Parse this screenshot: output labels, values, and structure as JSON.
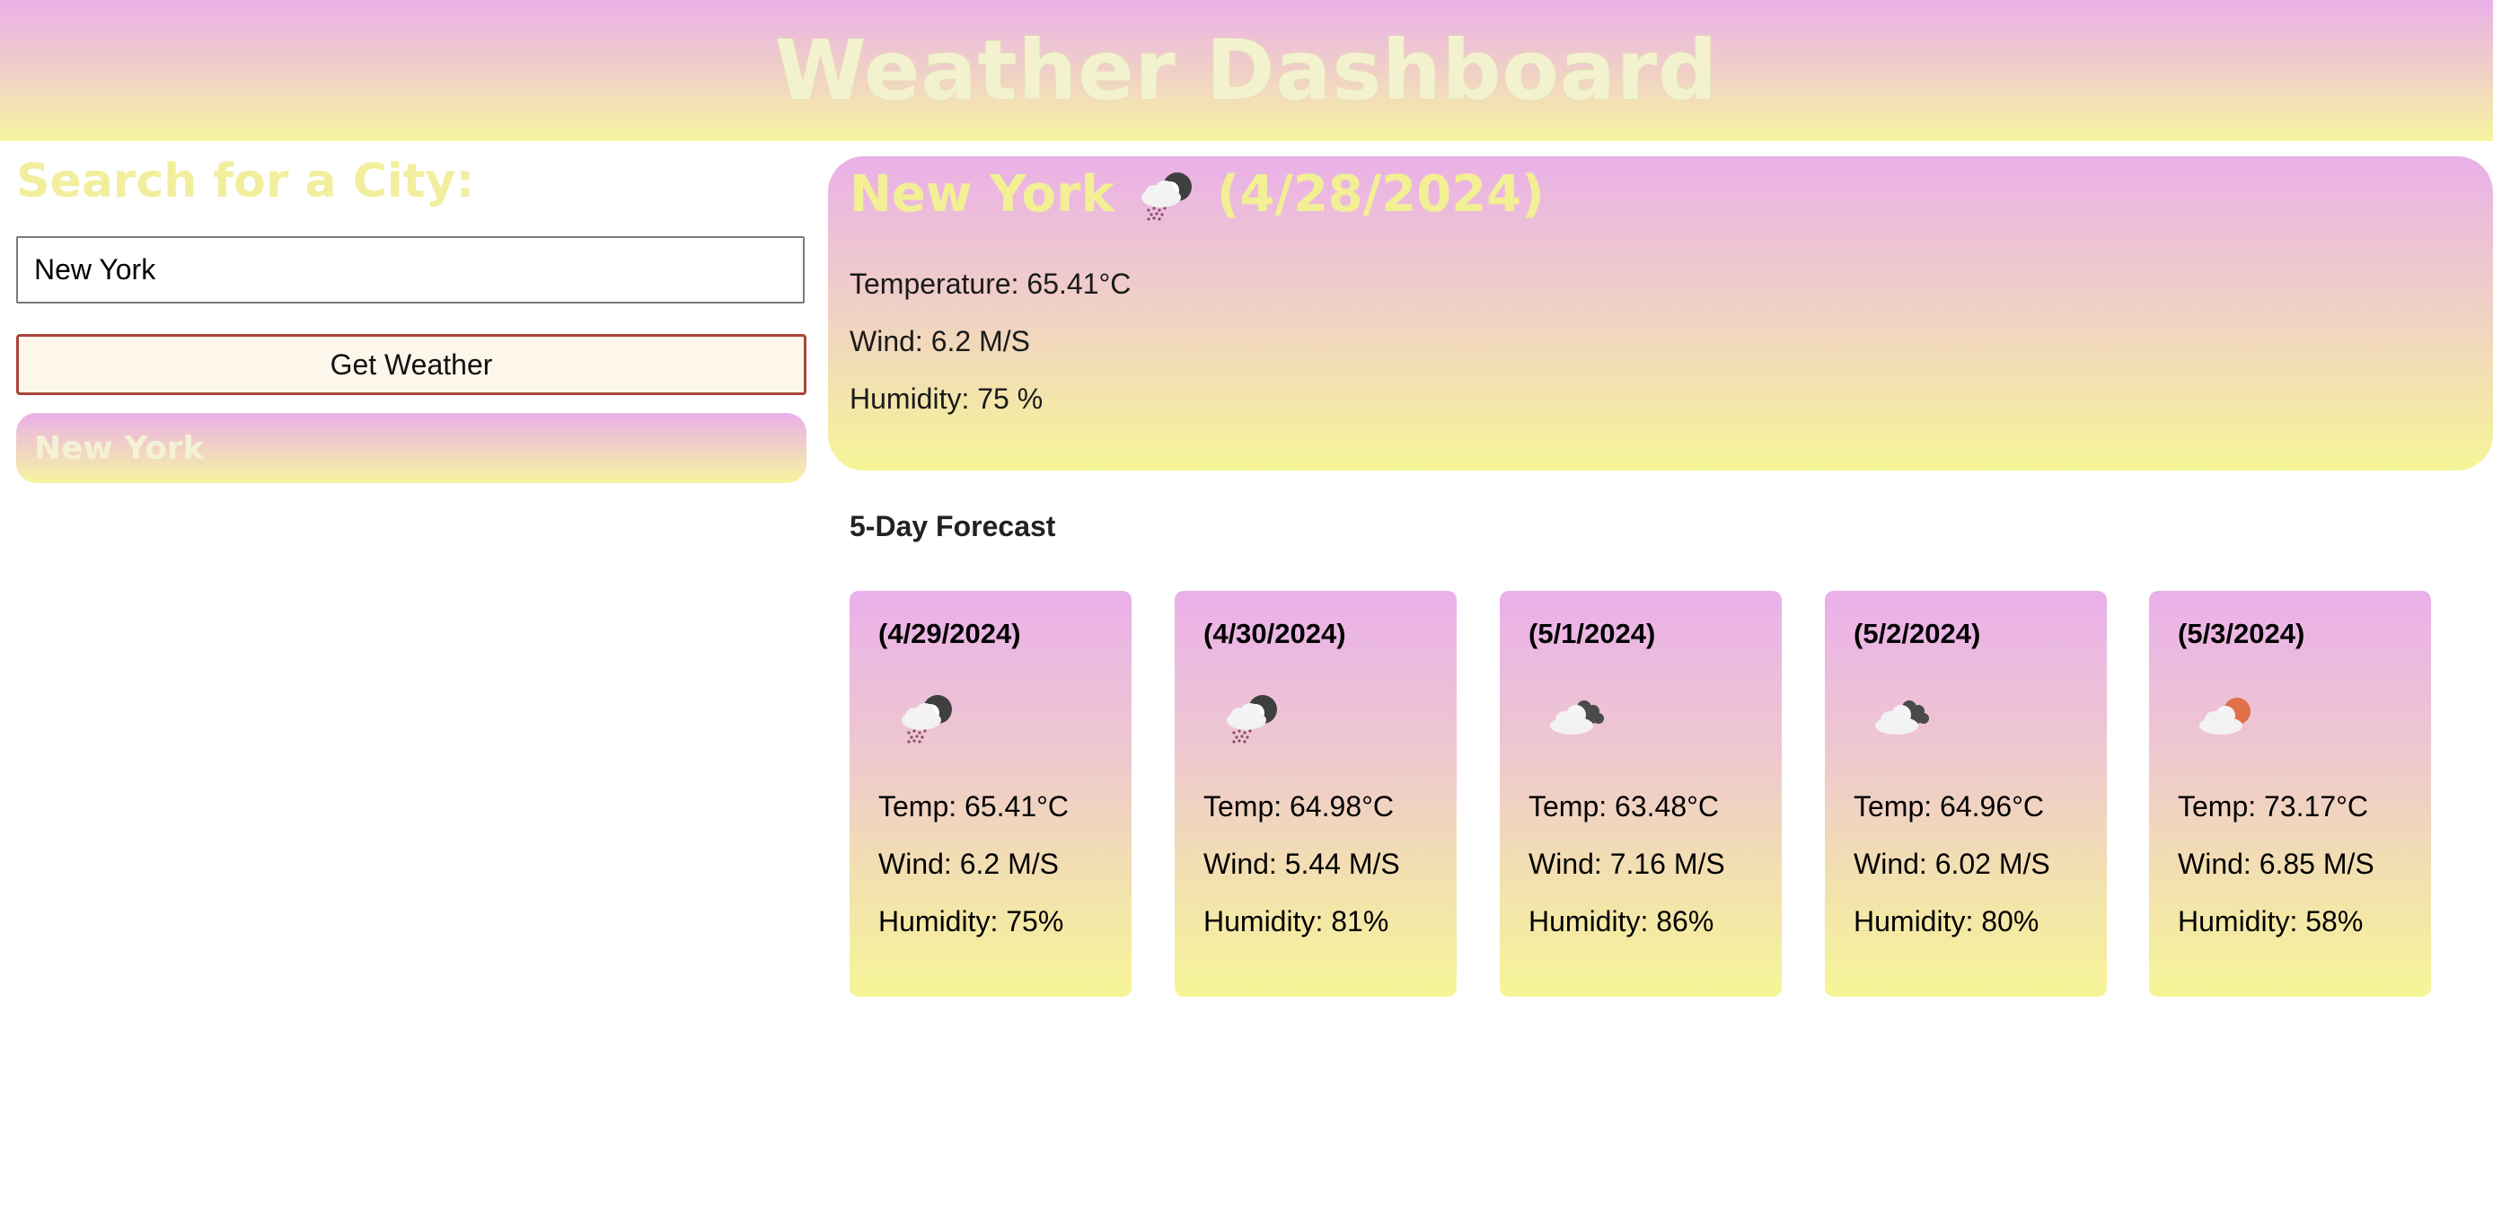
{
  "header": {
    "title": "Weather Dashboard"
  },
  "search": {
    "heading": "Search for a City:",
    "input_value": "New York",
    "button_label": "Get Weather",
    "history": [
      "New York"
    ]
  },
  "current": {
    "city": "New York",
    "icon": "rain-cloud-moon-icon",
    "date": "(4/28/2024)",
    "temperature": "Temperature: 65.41°C",
    "wind": "Wind: 6.2 M/S",
    "humidity": "Humidity: 75 %"
  },
  "forecast": {
    "heading": "5-Day Forecast",
    "days": [
      {
        "date": "(4/29/2024)",
        "icon": "rain-cloud-moon-icon",
        "temp": "Temp: 65.41°C",
        "wind": "Wind: 6.2 M/S",
        "humidity": "Humidity: 75%"
      },
      {
        "date": "(4/30/2024)",
        "icon": "rain-cloud-moon-icon",
        "temp": "Temp: 64.98°C",
        "wind": "Wind: 5.44 M/S",
        "humidity": "Humidity: 81%"
      },
      {
        "date": "(5/1/2024)",
        "icon": "broken-clouds-icon",
        "temp": "Temp: 63.48°C",
        "wind": "Wind: 7.16 M/S",
        "humidity": "Humidity: 86%"
      },
      {
        "date": "(5/2/2024)",
        "icon": "broken-clouds-icon",
        "temp": "Temp: 64.96°C",
        "wind": "Wind: 6.02 M/S",
        "humidity": "Humidity: 80%"
      },
      {
        "date": "(5/3/2024)",
        "icon": "few-clouds-sun-icon",
        "temp": "Temp: 73.17°C",
        "wind": "Wind: 6.85 M/S",
        "humidity": "Humidity: 58%"
      }
    ]
  },
  "colors": {
    "gradient_top": "#eab0e8",
    "gradient_bottom": "#f6f5a0",
    "title_text": "#f3f2cf",
    "heading_yellow": "#f1ef9d",
    "button_border": "#a8453a",
    "sun": "#e0704a"
  }
}
